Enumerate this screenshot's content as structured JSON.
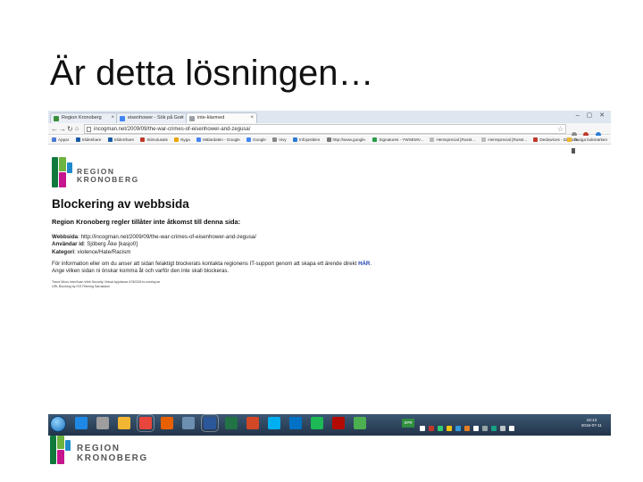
{
  "slide": {
    "title": "Är detta lösningen…"
  },
  "browser": {
    "tabs": [
      {
        "label": "Region Kronoberg",
        "active": false,
        "favicon_color": "#3a8f3a"
      },
      {
        "label": "eisenhower - Sök på Goo",
        "active": false,
        "favicon_color": "#4285f4"
      },
      {
        "label": "inte-klarmed",
        "active": true,
        "favicon_color": "#9aa0a6"
      }
    ],
    "window_controls": "– ▢ ✕",
    "address": "incogman.net/2009/09/the-war-crimes-of-eisenhower-and-zegusa/",
    "bookmarks": [
      {
        "label": "Appar",
        "color": "#4a7bd4"
      },
      {
        "label": "Slideshare",
        "color": "#1a5aa8"
      },
      {
        "label": "SlideShare",
        "color": "#1a5aa8"
      },
      {
        "label": "Stimulusals",
        "color": "#c0392b"
      },
      {
        "label": "Nyga",
        "color": "#f0a500"
      },
      {
        "label": "Mälardalen - Google",
        "color": "#4285f4"
      },
      {
        "label": "Google",
        "color": "#4285f4"
      },
      {
        "label": "Vivy",
        "color": "#888888"
      },
      {
        "label": "Infojustitien",
        "color": "#2a7dd4"
      },
      {
        "label": "http://www.google.",
        "color": "#777777"
      },
      {
        "label": "Signatures - YWSEMV...",
        "color": "#2a9d4a"
      },
      {
        "label": "Hemsprecial [Russt...",
        "color": "#bbbbbb"
      },
      {
        "label": "Hemsprecial [Russt...",
        "color": "#bbbbbb"
      },
      {
        "label": "Dedowices - Discove...",
        "color": "#c0392b"
      }
    ],
    "bookmarks_other": "Övriga bokmärken"
  },
  "page": {
    "logo": {
      "line1": "REGION",
      "line2": "KRONOBERG",
      "colors": [
        "#0f7a3c",
        "#6db33f",
        "#c6168d",
        "#1f8ac9"
      ]
    },
    "heading": "Blockering av webbsida",
    "subheading": "Region Kronoberg regler tillåter inte åtkomst till denna sida:",
    "fields": [
      {
        "label": "Webbsida",
        "value": ": http://incogman.net/2009/09/the-war-crimes-of-eisenhower-and-zegusa/"
      },
      {
        "label": "Användar id",
        "value": ": Sjöberg Åke [kasjo0]"
      },
      {
        "label": "Kategori",
        "value": ": violence/Hate/Racism"
      }
    ],
    "paragraph_line1": "För information eller om du anser att sidan felaktigt blockerats kontakta regionens IT-support genom att skapa ett ärende direkt ",
    "paragraph_link": "HÄR",
    "paragraph_line2": "Ange vilken sidan ni önskar komma åt och varför den inte skall blockeras.",
    "footnote_line1": "Trend Micro InterScan Web Security Virtual Appliance 6780328 ts.nmeisy.se",
    "footnote_line2": "URL Blocking by ISS Filtering Sarnladion"
  },
  "taskbar": {
    "apps": [
      {
        "name": "ie-icon",
        "color": "#1e88e5",
        "open": false
      },
      {
        "name": "tools-icon",
        "color": "#9e9e9e",
        "open": false
      },
      {
        "name": "folder-icon",
        "color": "#f2b632",
        "open": false
      },
      {
        "name": "chrome-icon",
        "color": "#e8453c",
        "open": true
      },
      {
        "name": "firefox-icon",
        "color": "#e66000",
        "open": false
      },
      {
        "name": "calendar-icon",
        "color": "#6d8fb0",
        "open": false
      },
      {
        "name": "word-icon",
        "color": "#2b579a",
        "open": true
      },
      {
        "name": "excel-icon",
        "color": "#217346",
        "open": false
      },
      {
        "name": "powerpoint-icon",
        "color": "#d24726",
        "open": false
      },
      {
        "name": "skype-icon",
        "color": "#00aff0",
        "open": false
      },
      {
        "name": "outlook-icon",
        "color": "#0072c6",
        "open": false
      },
      {
        "name": "spotify-icon",
        "color": "#1db954",
        "open": false
      },
      {
        "name": "acrobat-icon",
        "color": "#b30b00",
        "open": false
      },
      {
        "name": "signal-icon",
        "color": "#4caf50",
        "open": false
      }
    ],
    "tray_badge": "SPR",
    "tray_colors": [
      "#ffffff",
      "#c0392b",
      "#2ecc71",
      "#f1c40f",
      "#3498db",
      "#e67e22",
      "#ffffff",
      "#95a5a6",
      "#16a085",
      "#bdc3c7",
      "#ffffff"
    ],
    "clock_time": "16:13",
    "clock_date": "2016-07-11"
  }
}
